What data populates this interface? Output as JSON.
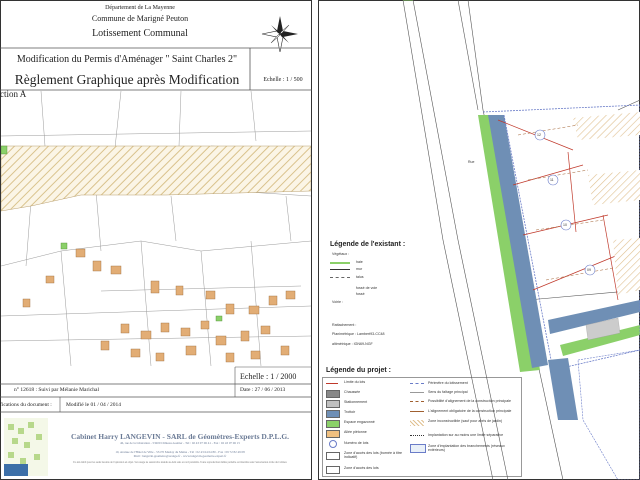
{
  "title_block": {
    "department": "Département de La Mayenne",
    "commune": "Commune de Marigné Peuton",
    "lotissement": "Lotissement Communal",
    "modification": "Modification du Permis d'Aménager \" Saint Charles 2\"",
    "reglement": "Règlement Graphique après Modification",
    "echelle_small": "Echelle : 1 / 500",
    "section": "ction A"
  },
  "footer_block": {
    "echelle": "Echelle : 1 / 2000",
    "date": "Date : 27 / 06 / 2013",
    "dossier": "n° 12618 : Suivi par Mélanie Marichal",
    "document_label": "fications du document :",
    "modified": "Modifié le 01 / 04 / 2014"
  },
  "cabinet": {
    "name": "Cabinet Harry LANGEVIN - SARL de Géomètres-Experts D.P.L.G.",
    "address": "46, rue de la Libération - 53200 Château-Gontier - Tél : 02 43 07 06 41 - Fax : 02 43 07 06 15",
    "address2": "10, Avenue de l'Hôtel de Ville - 53170 Meslay du Maine - Tél : 02 43 64 04 80 - Fax : 09 72 82 49 08",
    "web": "Mail : langevin.geometre@orange.fr - www.langevin-geometre-expert.fr",
    "fine_print": "Il a été établi pour les seuls besoins de l'opération en objet. Son usage ne saurait être étendu au-delà sans accord préalable. Toute reproduction même partielle est interdite sans l'autorisation écrite du Cabinet."
  },
  "legend_existing": {
    "title": "Légende de l'existant :",
    "vegetation": "Végétaux :",
    "items": [
      "haie",
      "mur",
      "talus"
    ],
    "fosse": "fossé de voie",
    "fosse2": "fossé",
    "voirie": "Voirie :",
    "rattachement": "Rattachement :",
    "planimetrique": "Planimétrique : Lambert93-CC48",
    "altimetrique": "altimétrique : IGN69-NGF"
  },
  "legend_project": {
    "title": "Légende du projet :",
    "left_items": [
      "Limite du lots",
      "Chaussée",
      "Stationnement",
      "Trottoir",
      "Espace engazonné",
      "Allée piétonne",
      "Numéro de lots",
      "Zone d'accès des lots (bornée à titre indicatif)",
      "Zone d'accès des lots"
    ],
    "right_items": [
      "Périmètre du lotissement",
      "Sens du faîtage principal",
      "Possibilité d'alignement de la construction principale",
      "L'alignement obligatoire de la construction principale",
      "Zone inconstructible (sauf pour abris de jardin)",
      "Implantation sur au moins une limite séparative",
      "Zone d'implantation des branchements (réseaux extérieurs)"
    ]
  },
  "lot_numbers": [
    "12",
    "11",
    "10",
    "09"
  ],
  "street_label": "Rue",
  "colors": {
    "hatch": "#d9c28c",
    "building": "#e2ad75",
    "road": "#6f8fb5",
    "grass": "#8bd069",
    "lot_line": "#c0392b",
    "perimeter": "#6a7cc8"
  }
}
